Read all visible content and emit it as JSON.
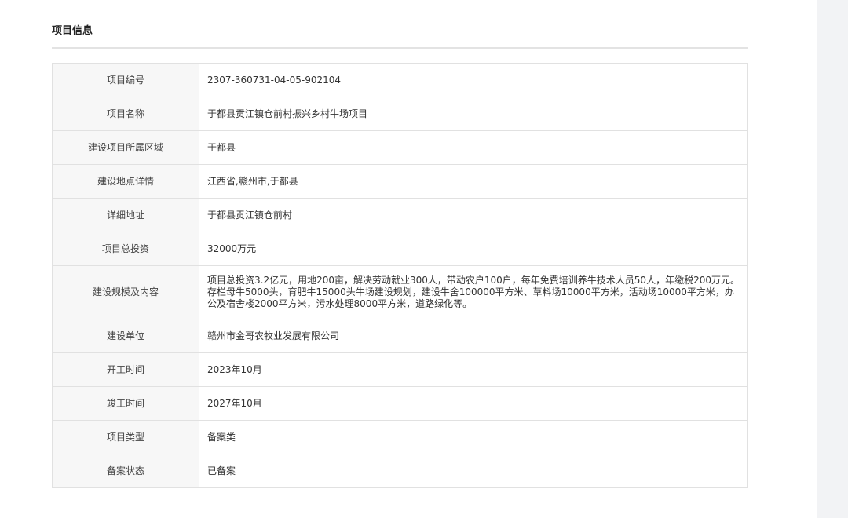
{
  "section": {
    "title": "项目信息"
  },
  "rows": [
    {
      "label": "项目编号",
      "value": "2307-360731-04-05-902104"
    },
    {
      "label": "项目名称",
      "value": "于都县贡江镇仓前村振兴乡村牛场项目"
    },
    {
      "label": "建设项目所属区域",
      "value": "于都县"
    },
    {
      "label": "建设地点详情",
      "value": "江西省,赣州市,于都县"
    },
    {
      "label": "详细地址",
      "value": "于都县贡江镇仓前村"
    },
    {
      "label": "项目总投资",
      "value": "32000万元"
    },
    {
      "label": "建设规模及内容",
      "value": "项目总投资3.2亿元，用地200亩，解决劳动就业300人，带动农户100户，每年免费培训养牛技术人员50人，年缴税200万元。存栏母牛5000头，育肥牛15000头牛场建设规划，建设牛舍100000平方米、草料场10000平方米，活动场10000平方米，办公及宿舍楼2000平方米，污水处理8000平方米，道路绿化等。"
    },
    {
      "label": "建设单位",
      "value": "赣州市金哥农牧业发展有限公司"
    },
    {
      "label": "开工时间",
      "value": "2023年10月"
    },
    {
      "label": "竣工时间",
      "value": "2027年10月"
    },
    {
      "label": "项目类型",
      "value": "备案类"
    },
    {
      "label": "备案状态",
      "value": "已备案"
    }
  ]
}
